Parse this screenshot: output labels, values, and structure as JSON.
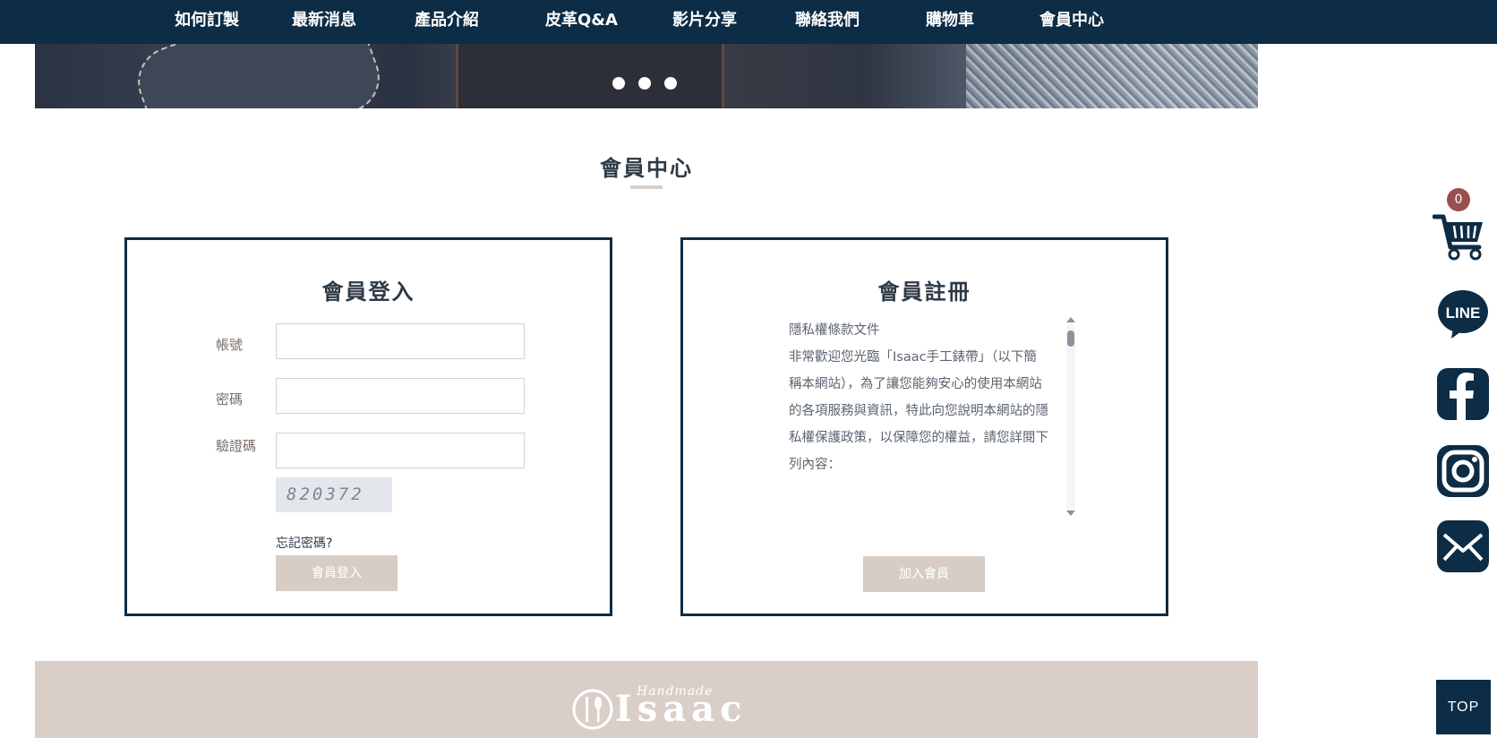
{
  "nav": {
    "items": [
      {
        "label": "如何訂製"
      },
      {
        "label": "最新消息"
      },
      {
        "label": "產品介紹"
      },
      {
        "label": "皮革Q&A"
      },
      {
        "label": "影片分享"
      },
      {
        "label": "聯絡我們"
      },
      {
        "label": "購物車"
      },
      {
        "label": "會員中心"
      }
    ]
  },
  "hero": {
    "slide_count": 3
  },
  "page": {
    "title": "會員中心"
  },
  "login": {
    "heading": "會員登入",
    "account_label": "帳號",
    "account_value": "",
    "password_label": "密碼",
    "password_value": "",
    "captcha_label": "驗證碼",
    "captcha_value": "",
    "captcha_code": "820372",
    "forgot_label": "忘記密碼?",
    "submit_label": "會員登入"
  },
  "register": {
    "heading": "會員註冊",
    "terms_title": "隱私權條款文件",
    "terms_body": "非常歡迎您光臨「Isaac手工錶帶」（以下簡稱本網站），為了讓您能夠安心的使用本網站的各項服務與資訊，特此向您說明本網站的隱私權保護政策，以保障您的權益，請您詳閱下列內容：",
    "join_label": "加入會員"
  },
  "footer": {
    "logo_word": "Isaac",
    "logo_script": "Handmade"
  },
  "side": {
    "cart_count": "0",
    "icons": [
      "cart-icon",
      "line-icon",
      "facebook-icon",
      "instagram-icon",
      "mail-icon"
    ],
    "line_text": "LINE",
    "top_label": "TOP"
  },
  "colors": {
    "nav_bg": "#0d2c45",
    "accent_beige": "#d8cdc6",
    "badge": "#9a4f4f",
    "text_dark": "#2d3a46"
  }
}
